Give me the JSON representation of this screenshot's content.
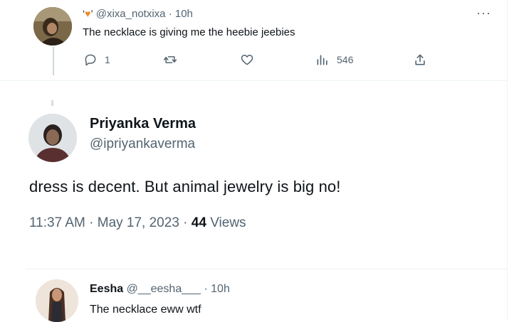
{
  "top_reply": {
    "header_prefix": "‘",
    "header_suffix": "’",
    "handle": "@xixa_notxixa",
    "time": "· 10h",
    "text": "The necklace is giving me the heebie jeebies",
    "more": "···",
    "reply_count": "1",
    "views_count": "546"
  },
  "main_tweet": {
    "name": "Priyanka Verma",
    "handle": "@ipriyankaverma",
    "text": "dress is decent. But animal jewelry is big no!",
    "timestamp": "11:37 AM · May 17, 2023 · ",
    "views_number": "44",
    "views_label": " Views"
  },
  "bottom_reply": {
    "name": "Eesha",
    "handle": "@__eesha___",
    "time": "· 10h",
    "text": "The necklace eww wtf"
  },
  "colors": {
    "text_primary": "#0f1419",
    "text_secondary": "#536471",
    "divider": "#eff3f4",
    "heart_emoji": "#f08a24"
  }
}
